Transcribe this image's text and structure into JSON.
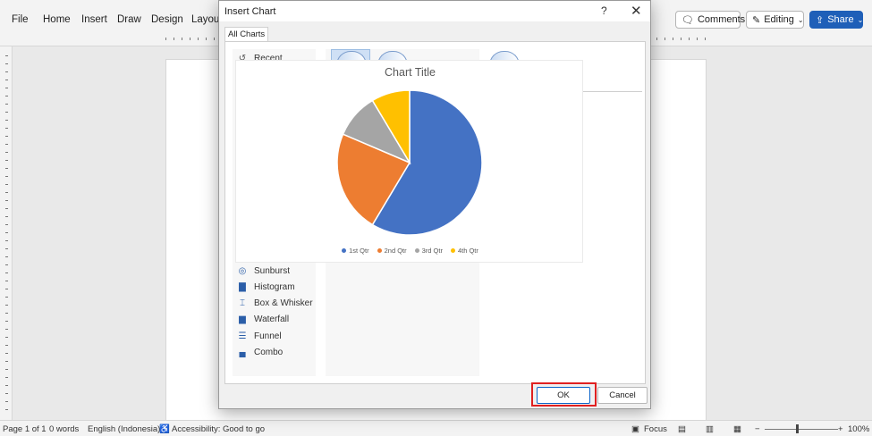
{
  "menu": [
    "File",
    "Home",
    "Insert",
    "Draw",
    "Design",
    "Layout"
  ],
  "ribbon_right": {
    "comments": "Comments",
    "editing": "Editing",
    "share": "Share"
  },
  "dialog": {
    "title": "Insert Chart",
    "help": "?",
    "close": "✕",
    "tab": "All Charts",
    "recent": "Recent",
    "chart_types": [
      {
        "label": "Sunburst",
        "icon": "sunburst-icon"
      },
      {
        "label": "Histogram",
        "icon": "histogram-icon"
      },
      {
        "label": "Box & Whisker",
        "icon": "box-whisker-icon"
      },
      {
        "label": "Waterfall",
        "icon": "waterfall-icon"
      },
      {
        "label": "Funnel",
        "icon": "funnel-icon"
      },
      {
        "label": "Combo",
        "icon": "combo-icon"
      }
    ],
    "ok": "OK",
    "cancel": "Cancel"
  },
  "chart_data": {
    "type": "pie",
    "title": "Chart Title",
    "categories": [
      "1st Qtr",
      "2nd Qtr",
      "3rd Qtr",
      "4th Qtr"
    ],
    "values": [
      8.2,
      3.2,
      1.4,
      1.2
    ],
    "colors": [
      "#4472c4",
      "#ed7d31",
      "#a5a5a5",
      "#ffc000"
    ],
    "legend_position": "bottom"
  },
  "status": {
    "page": "Page 1 of 1",
    "words": "0 words",
    "language": "English (Indonesia)",
    "accessibility": "Accessibility: Good to go",
    "focus": "Focus",
    "zoom": "100%"
  }
}
